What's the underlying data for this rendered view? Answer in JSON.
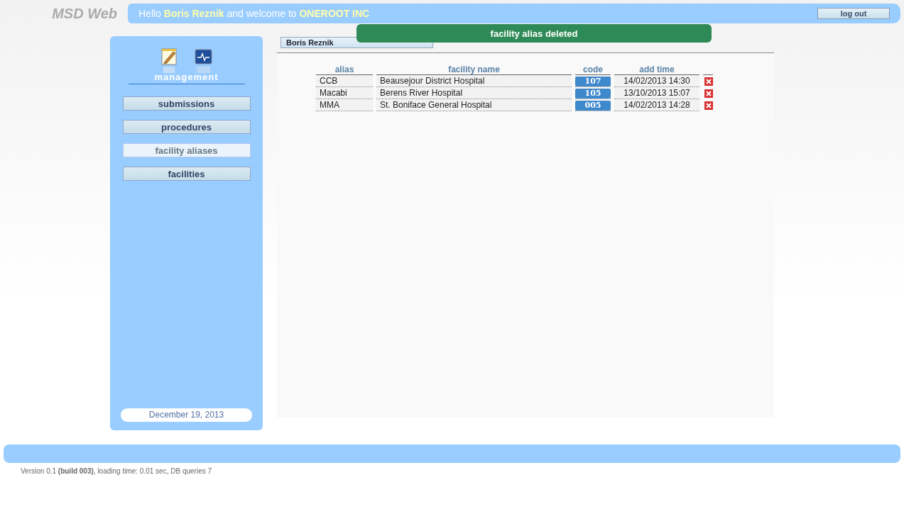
{
  "header": {
    "logo": "MSD Web",
    "greeting": "Hello **Boris Reznik** and welcome to **ONEROOT INC**",
    "logout": "log out"
  },
  "sidebar": {
    "section": "management",
    "items": [
      {
        "label": "submissions",
        "selected": false
      },
      {
        "label": "procedures",
        "selected": false
      },
      {
        "label": "facility aliases",
        "selected": true
      },
      {
        "label": "facilities",
        "selected": false
      }
    ],
    "date": "December 19, 2013"
  },
  "user_select": {
    "value": "Boris Reznik"
  },
  "toast": "facility alias deleted",
  "table": {
    "columns": [
      "alias",
      "facility name",
      "code",
      "add time"
    ],
    "rows": [
      {
        "alias": "CCB",
        "facility_name": "Beausejour District Hospital",
        "code": "107",
        "add_time": "14/02/2013 14:30"
      },
      {
        "alias": "Macabi",
        "facility_name": "Berens River Hospital",
        "code": "105",
        "add_time": "13/10/2013 15:07"
      },
      {
        "alias": "MMA",
        "facility_name": "St. Boniface General Hospital",
        "code": "005",
        "add_time": "14/02/2013 14:28"
      }
    ]
  },
  "footer": {
    "version": "Version 0.1 **(build 003)**, loading time: 0.01 sec, DB queries 7"
  }
}
